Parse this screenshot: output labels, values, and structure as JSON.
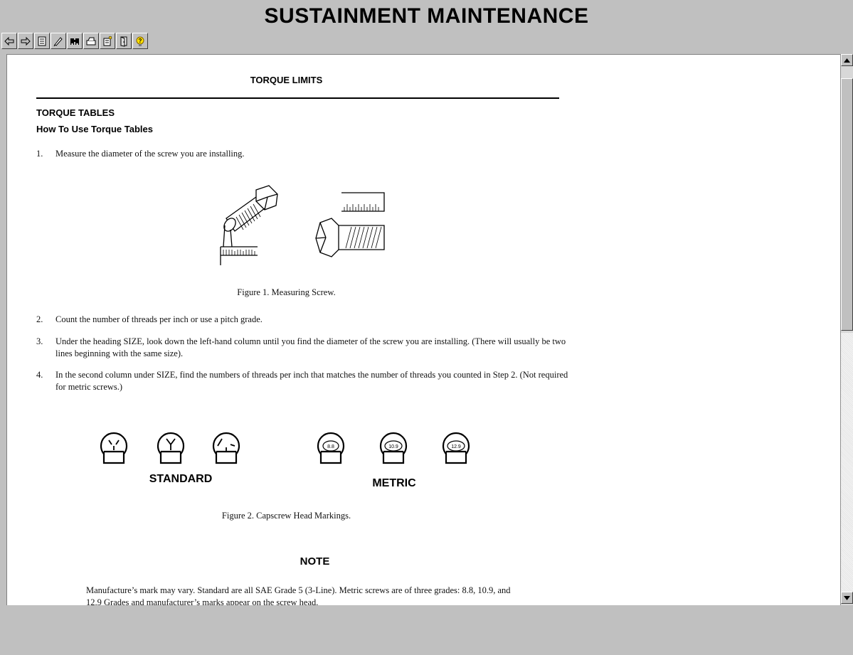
{
  "app": {
    "title": "SUSTAINMENT MAINTENANCE"
  },
  "toolbar": {
    "buttons": [
      {
        "icon": "back-arrow-icon"
      },
      {
        "icon": "forward-arrow-icon"
      },
      {
        "icon": "save-icon"
      },
      {
        "icon": "pen-icon"
      },
      {
        "icon": "binoculars-icon"
      },
      {
        "icon": "print-icon"
      },
      {
        "icon": "notes-icon"
      },
      {
        "icon": "exit-door-icon"
      },
      {
        "icon": "help-icon"
      }
    ]
  },
  "document": {
    "title": "TORQUE LIMITS",
    "section": "TORQUE TABLES",
    "subsection": "How To Use Torque Tables",
    "steps": [
      {
        "num": "1.",
        "text": "Measure the diameter of the screw you are installing."
      },
      {
        "num": "2.",
        "text": "Count the number of threads per inch or use a pitch grade."
      },
      {
        "num": "3.",
        "text": "Under the heading SIZE, look down the left-hand column until you find the diameter of the screw you are installing. (There will usually be two lines beginning with the same size)."
      },
      {
        "num": "4.",
        "text": "In the second column under SIZE, find the numbers of threads per inch that matches the number of threads you counted in Step 2. (Not required for metric screws.)"
      }
    ],
    "figure1_caption": "Figure 1.   Measuring Screw.",
    "figure2": {
      "caption": "Figure 2.   Capscrew Head Markings.",
      "standard_label": "STANDARD",
      "metric_label": "METRIC",
      "metric_grades": [
        "8.8",
        "10.9",
        "12.9"
      ]
    },
    "note_title": "NOTE",
    "note_text": "Manufacture’s mark may vary. Standard are all SAE Grade 5 (3-Line). Metric screws are of three grades: 8.8, 10.9, and 12.9 Grades and manufacturer’s marks appear on the screw head."
  },
  "scrollbar": {
    "up_icon": "scroll-up-arrow-icon",
    "down_icon": "scroll-down-arrow-icon"
  }
}
